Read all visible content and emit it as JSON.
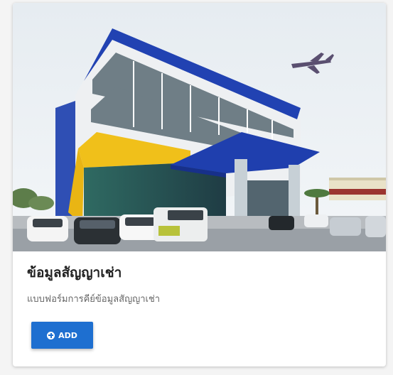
{
  "card": {
    "title": "ข้อมูลสัญญาเช่า",
    "description": "แบบฟอร์มการคีย์ข้อมูลสัญญาเช่า",
    "button": {
      "icon": "plus-circle-icon",
      "label": "ADD"
    },
    "image": {
      "subject": "office-building-with-airplane"
    }
  },
  "colors": {
    "accent": "#1e6fd0",
    "title": "#222222",
    "description": "#666666",
    "card_background": "#ffffff",
    "page_background": "#f4f4f4"
  }
}
